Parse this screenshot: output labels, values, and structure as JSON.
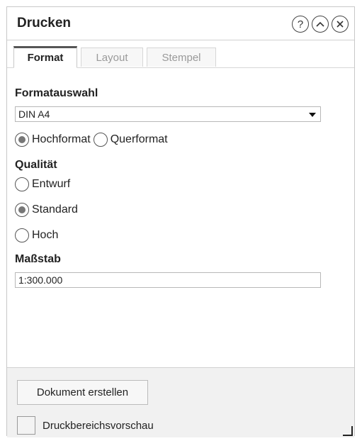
{
  "dialog": {
    "title": "Drucken"
  },
  "tabs": [
    {
      "label": "Format",
      "active": true
    },
    {
      "label": "Layout",
      "active": false
    },
    {
      "label": "Stempel",
      "active": false
    }
  ],
  "format": {
    "format_label": "Formatauswahl",
    "format_value": "DIN A4",
    "orientation": [
      {
        "label": "Hochformat",
        "checked": true
      },
      {
        "label": "Querformat",
        "checked": false
      }
    ],
    "quality_label": "Qualität",
    "quality": [
      {
        "label": "Entwurf",
        "checked": false
      },
      {
        "label": "Standard",
        "checked": true
      },
      {
        "label": "Hoch",
        "checked": false
      }
    ],
    "scale_label": "Maßstab",
    "scale_value": "1:300.000"
  },
  "footer": {
    "create_button": "Dokument erstellen",
    "preview_label": "Druckbereichsvorschau",
    "preview_checked": false
  },
  "icons": {
    "help": "help-icon",
    "collapse": "collapse-icon",
    "close": "close-icon"
  }
}
